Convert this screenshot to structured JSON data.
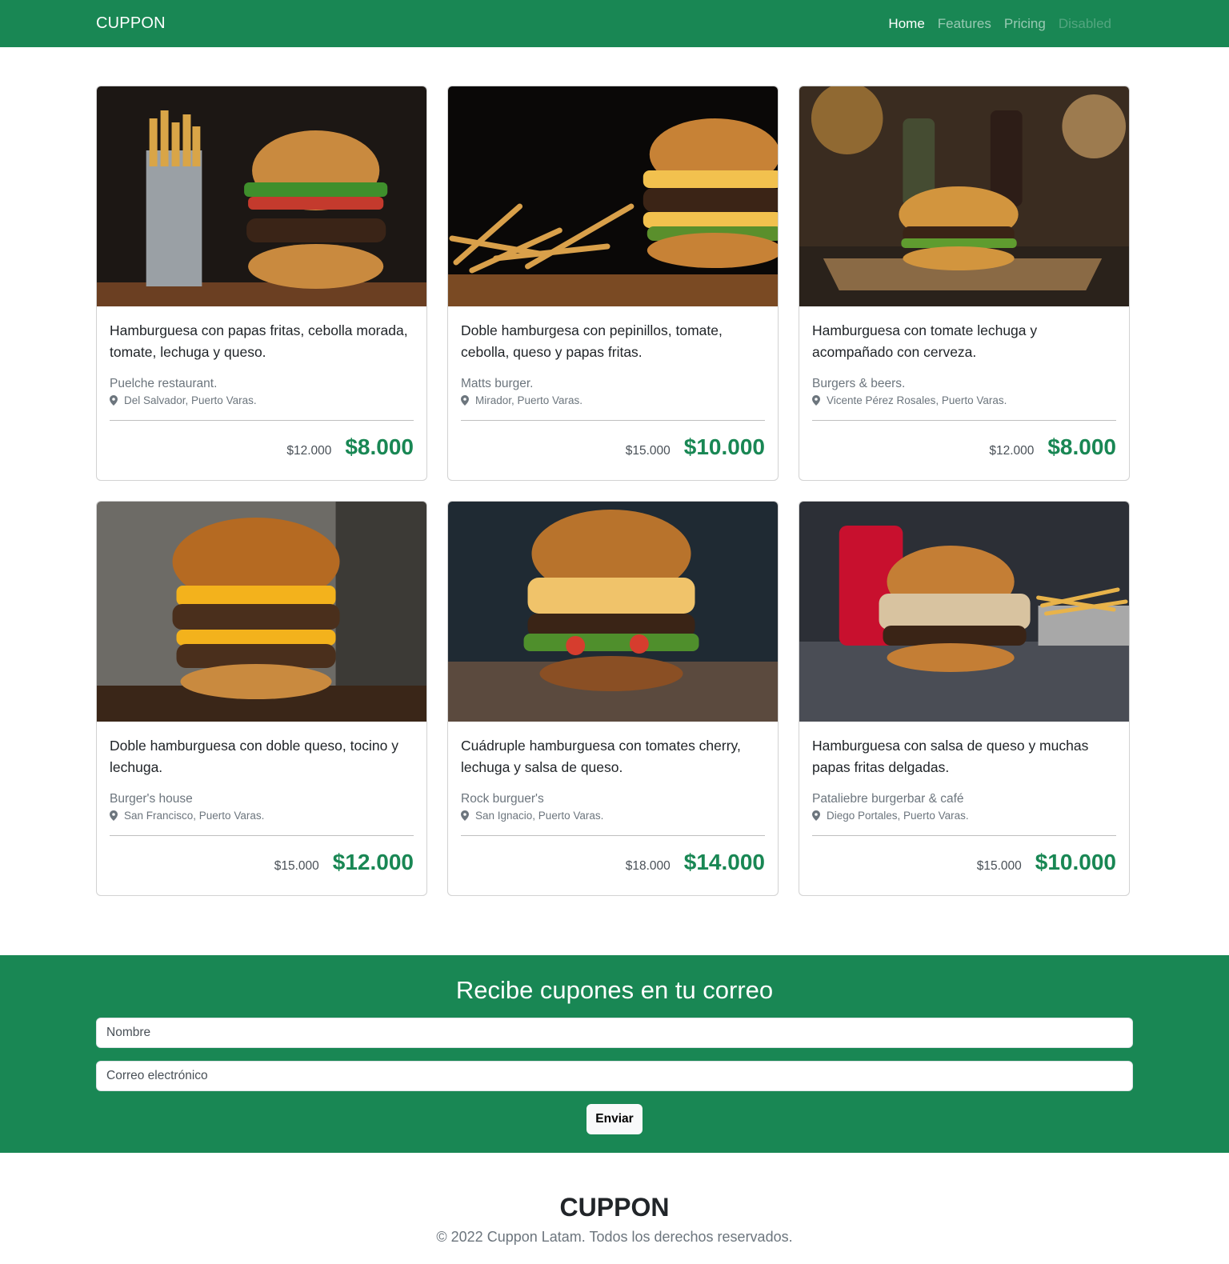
{
  "nav": {
    "brand": "CUPPON",
    "links": [
      "Home",
      "Features",
      "Pricing",
      "Disabled"
    ]
  },
  "cards": [
    {
      "title": "Hamburguesa con papas fritas, cebolla morada, tomate, lechuga y queso.",
      "restaurant": "Puelche restaurant.",
      "location": "Del Salvador, Puerto Varas.",
      "old_price": "$12.000",
      "new_price": "$8.000"
    },
    {
      "title": "Doble hamburgesa con pepinillos, tomate, cebolla, queso y papas fritas.",
      "restaurant": "Matts burger.",
      "location": "Mirador, Puerto Varas.",
      "old_price": "$15.000",
      "new_price": "$10.000"
    },
    {
      "title": "Hamburguesa con tomate lechuga y acompañado con cerveza.",
      "restaurant": "Burgers & beers.",
      "location": "Vicente Pérez Rosales, Puerto Varas.",
      "old_price": "$12.000",
      "new_price": "$8.000"
    },
    {
      "title": "Doble hamburguesa con doble queso, tocino y lechuga.",
      "restaurant": "Burger's house",
      "location": "San Francisco, Puerto Varas.",
      "old_price": "$15.000",
      "new_price": "$12.000"
    },
    {
      "title": "Cuádruple hamburguesa con tomates cherry, lechuga y salsa de queso.",
      "restaurant": "Rock burguer's",
      "location": "San Ignacio, Puerto Varas.",
      "old_price": "$18.000",
      "new_price": "$14.000"
    },
    {
      "title": "Hamburguesa con salsa de queso y muchas papas fritas delgadas.",
      "restaurant": "Pataliebre burgerbar & café",
      "location": "Diego Portales, Puerto Varas.",
      "old_price": "$15.000",
      "new_price": "$10.000"
    }
  ],
  "subscribe": {
    "heading": "Recibe cupones en tu correo",
    "name_placeholder": "Nombre",
    "email_placeholder": "Correo electrónico",
    "submit_label": "Enviar"
  },
  "footer": {
    "brand": "CUPPON",
    "copyright": "© 2022 Cuppon Latam. Todos los derechos reservados."
  },
  "colors": {
    "brand_green": "#198754",
    "text_dark": "#212529",
    "text_muted": "#6c757d"
  }
}
